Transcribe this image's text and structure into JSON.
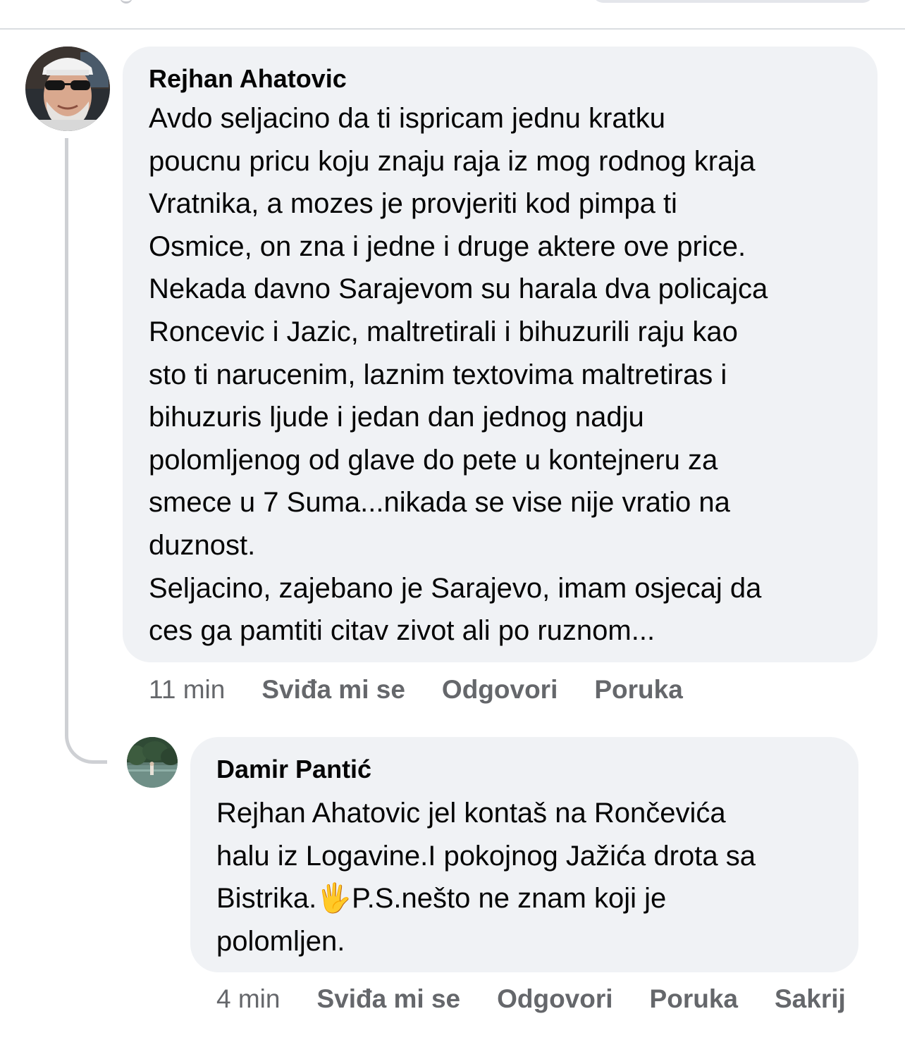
{
  "comments": [
    {
      "author": "Rejhan Ahatovic",
      "text": "Avdo seljacino da ti ispricam jednu kratku\npoucnu pricu koju znaju raja iz mog rodnog kraja\nVratnika, a mozes je provjeriti kod pimpa ti\nOsmice, on zna i jedne i druge aktere ove price.\nNekada davno Sarajevom su harala dva policajca\nRoncevic i Jazic, maltretirali i bihuzurili raju kao\nsto ti narucenim, laznim textovima maltretiras i\nbihuzuris ljude i jedan dan jednog nadju\npolomljenog od glave do pete u kontejneru za\nsmece u 7 Suma...nikada se vise nije vratio na\nduznost.\nSeljacino, zajebano je Sarajevo, imam osjecaj da\nces ga pamtiti citav zivot ali po ruznom...",
      "time": "11 min",
      "actions": {
        "like": "Sviđa mi se",
        "reply": "Odgovori",
        "message": "Poruka"
      }
    },
    {
      "author": "Damir Pantić",
      "text_before": "Rejhan Ahatovic jel kontaš na Rončevića\nhalu iz Logavine.I pokojnog Jažića drota sa\nBistrika.",
      "emoji": "🖐",
      "text_after": "P.S.nešto ne znam koji je\npolomljen.",
      "time": "4 min",
      "actions": {
        "like": "Sviđa mi se",
        "reply": "Odgovori",
        "message": "Poruka",
        "hide": "Sakrij"
      }
    }
  ],
  "colors": {
    "bubble": "#f0f2f5",
    "text": "#050505",
    "meta": "#65676b",
    "thread_line": "#ced0d4"
  }
}
